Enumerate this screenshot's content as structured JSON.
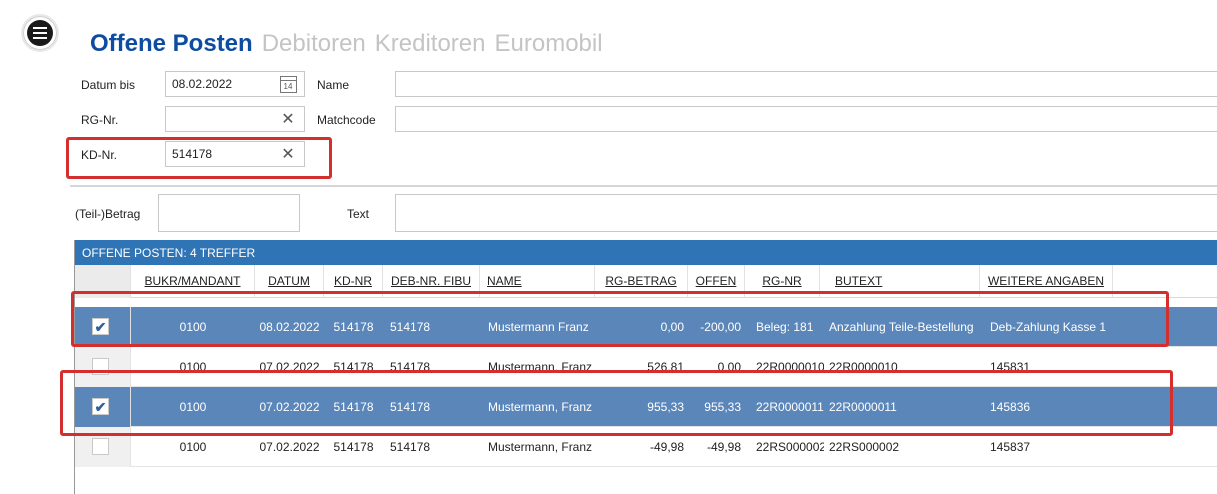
{
  "tabs": [
    {
      "label": "Offene Posten",
      "active": true
    },
    {
      "label": "Debitoren",
      "active": false
    },
    {
      "label": "Kreditoren",
      "active": false
    },
    {
      "label": "Euromobil",
      "active": false
    }
  ],
  "filters": {
    "datum_label": "Datum bis",
    "datum_value": "08.02.2022",
    "calendar_day": "14",
    "name_label": "Name",
    "name_value": "",
    "rg_label": "RG-Nr.",
    "rg_value": "",
    "matchcode_label": "Matchcode",
    "matchcode_value": "",
    "kd_label": "KD-Nr.",
    "kd_value": "514178",
    "betrag_label": "(Teil-)Betrag",
    "betrag_value": "",
    "text_label": "Text",
    "text_value": "",
    "clear_glyph": "✕"
  },
  "grid": {
    "title": "OFFENE POSTEN: 4 TREFFER",
    "columns": [
      "",
      "BUKR/MANDANT",
      "DATUM",
      "KD-NR",
      "DEB-NR. FIBU",
      "NAME",
      "RG-BETRAG",
      "OFFEN",
      "RG-NR",
      "BUTEXT",
      "WEITERE ANGABEN"
    ],
    "rows": [
      {
        "checked": true,
        "selected": true,
        "bukr": "0100",
        "datum": "08.02.2022",
        "kd": "514178",
        "deb": "514178",
        "name": "Mustermann Franz",
        "betrag": "0,00",
        "offen": "-200,00",
        "rgnr": "Beleg: 181",
        "butext": "Anzahlung Teile-Bestellung",
        "weitere": "Deb-Zahlung Kasse 1"
      },
      {
        "checked": false,
        "selected": false,
        "bukr": "0100",
        "datum": "07.02.2022",
        "kd": "514178",
        "deb": "514178",
        "name": "Mustermann, Franz",
        "betrag": "526,81",
        "offen": "0,00",
        "rgnr": "22R0000010",
        "butext": "22R0000010",
        "weitere": "145831"
      },
      {
        "checked": true,
        "selected": true,
        "bukr": "0100",
        "datum": "07.02.2022",
        "kd": "514178",
        "deb": "514178",
        "name": "Mustermann, Franz",
        "betrag": "955,33",
        "offen": "955,33",
        "rgnr": "22R0000011",
        "butext": "22R0000011",
        "weitere": "145836"
      },
      {
        "checked": false,
        "selected": false,
        "bukr": "0100",
        "datum": "07.02.2022",
        "kd": "514178",
        "deb": "514178",
        "name": "Mustermann, Franz",
        "betrag": "-49,98",
        "offen": "-49,98",
        "rgnr": "22RS000002",
        "butext": "22RS000002",
        "weitere": "145837"
      }
    ]
  },
  "colors": {
    "accent": "#0d4da1",
    "header_bar": "#2f74b5",
    "selected_row": "#5b86b9",
    "highlight_box": "#d32f2f"
  }
}
